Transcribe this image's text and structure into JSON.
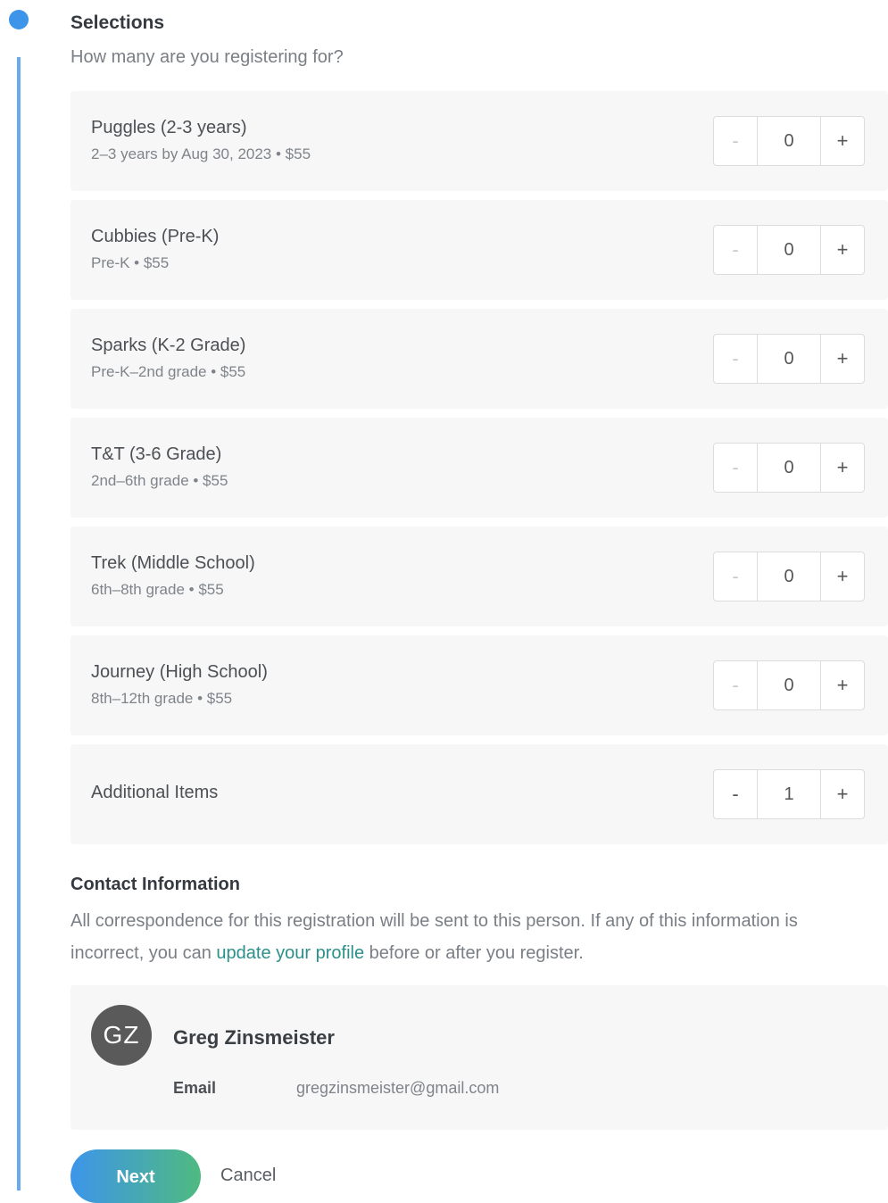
{
  "selections": {
    "title": "Selections",
    "subtitle": "How many are you registering for?",
    "rows": [
      {
        "name": "Puggles (2-3 years)",
        "detail": "2–3 years by Aug 30, 2023 • $55",
        "quantity": "0",
        "minus": "-",
        "plus": "+"
      },
      {
        "name": "Cubbies (Pre-K)",
        "detail": "Pre-K • $55",
        "quantity": "0",
        "minus": "-",
        "plus": "+"
      },
      {
        "name": "Sparks (K-2 Grade)",
        "detail": "Pre-K–2nd grade • $55",
        "quantity": "0",
        "minus": "-",
        "plus": "+"
      },
      {
        "name": "T&T (3-6 Grade)",
        "detail": "2nd–6th grade • $55",
        "quantity": "0",
        "minus": "-",
        "plus": "+"
      },
      {
        "name": "Trek (Middle School)",
        "detail": "6th–8th grade • $55",
        "quantity": "0",
        "minus": "-",
        "plus": "+"
      },
      {
        "name": "Journey (High School)",
        "detail": "8th–12th grade • $55",
        "quantity": "0",
        "minus": "-",
        "plus": "+"
      },
      {
        "name": "Additional Items",
        "detail": "",
        "quantity": "1",
        "minus": "-",
        "plus": "+"
      }
    ]
  },
  "contact": {
    "title": "Contact Information",
    "text_before": "All correspondence for this registration will be sent to this person. If any of this information is incorrect, you can ",
    "link": "update your profile",
    "text_after": " before or after you register.",
    "avatar_initials": "GZ",
    "name": "Greg Zinsmeister",
    "email_label": "Email",
    "email": "gregzinsmeister@gmail.com"
  },
  "actions": {
    "next": "Next",
    "cancel": "Cancel"
  },
  "colors": {
    "accent": "#3d95ea",
    "link": "#2b8f8a",
    "gradient_end": "#4fba80"
  }
}
